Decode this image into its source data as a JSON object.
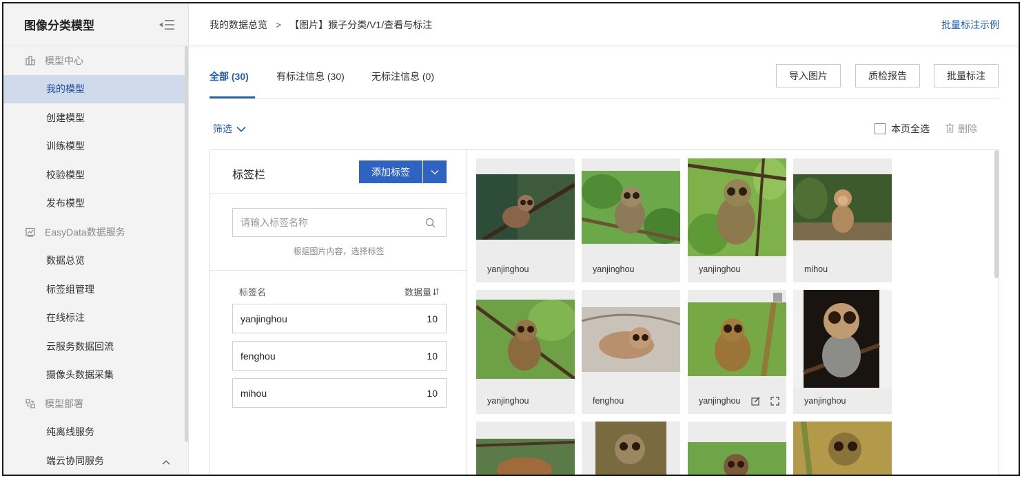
{
  "sidebar": {
    "title": "图像分类模型",
    "groups": {
      "model_center": "模型中心",
      "easydata": "EasyData数据服务",
      "deploy": "模型部署"
    },
    "items": {
      "my_models": "我的模型",
      "create": "创建模型",
      "train": "训练模型",
      "verify": "校验模型",
      "publish": "发布模型",
      "data_overview": "数据总览",
      "label_groups": "标签组管理",
      "online_label": "在线标注",
      "cloud_backflow": "云服务数据回流",
      "camera_collect": "摄像头数据采集",
      "offline_service": "纯离线服务",
      "edge_cloud": "端云协同服务"
    }
  },
  "breadcrumb": {
    "root": "我的数据总览",
    "separator": ">",
    "current": "【图片】猴子分类/V1/查看与标注"
  },
  "header_link": "批量标注示例",
  "tabs": [
    {
      "label": "全部 (30)",
      "active": true
    },
    {
      "label": "有标注信息 (30)",
      "active": false
    },
    {
      "label": "无标注信息 (0)",
      "active": false
    }
  ],
  "actions": {
    "import": "导入图片",
    "quality_report": "质检报告",
    "batch_label": "批量标注"
  },
  "filter_label": "筛选",
  "select_all_label": "本页全选",
  "delete_label": "删除",
  "label_panel": {
    "title": "标签栏",
    "add_button": "添加标签",
    "search_placeholder": "请输入标签名称",
    "hint": "根据图片内容，选择标签",
    "col_name": "标签名",
    "col_count": "数据量",
    "labels": [
      {
        "name": "yanjinghou",
        "count": "10"
      },
      {
        "name": "fenghou",
        "count": "10"
      },
      {
        "name": "mihou",
        "count": "10"
      }
    ]
  },
  "images": [
    {
      "label": "yanjinghou"
    },
    {
      "label": "yanjinghou"
    },
    {
      "label": "yanjinghou"
    },
    {
      "label": "mihou"
    },
    {
      "label": "yanjinghou"
    },
    {
      "label": "fenghou"
    },
    {
      "label": "yanjinghou"
    },
    {
      "label": "yanjinghou"
    }
  ],
  "colors": {
    "accent": "#1f5bc6",
    "button_blue": "#2f63c2",
    "active_nav_bg": "#cfdaeb",
    "sidebar_bg": "#f3f3f3"
  }
}
